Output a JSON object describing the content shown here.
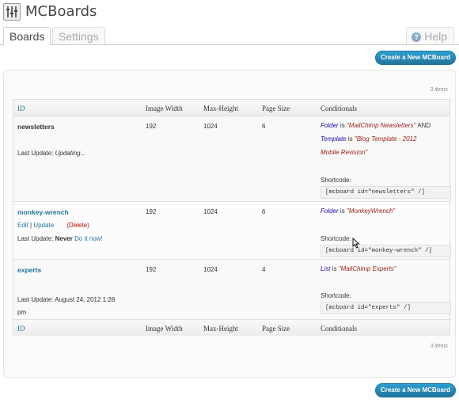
{
  "app": {
    "title": "MCBoards"
  },
  "tabs": [
    {
      "label": "Boards",
      "active": true
    },
    {
      "label": "Settings",
      "active": false
    }
  ],
  "help": {
    "label": "Help",
    "icon": "help-icon"
  },
  "buttons": {
    "create_label": "Create a New MCBoard"
  },
  "items_count": "3 items",
  "columns": [
    "ID",
    "Image Width",
    "Max-Height",
    "Page Size",
    "Conditionals"
  ],
  "rows": [
    {
      "name": "newsletters",
      "image_width": "192",
      "max_height": "1024",
      "page_size": "6",
      "last_update_label": "Last Update:",
      "last_update_value": "Updating...",
      "cond_line1_field": "Folder",
      "cond_line1_is": "is",
      "cond_line1_value": "\"MailChimp Newsletters\"",
      "cond_line1_and": "AND",
      "cond_line2_field": "Template",
      "cond_line2_is": "is",
      "cond_line2_value": "\"Blog Template - 2012",
      "cond_line3_value": "Mobile Revision\"",
      "shortcode_label": "Shortcode:",
      "shortcode": "[mcboard id=\"newsletters\" /]"
    },
    {
      "name": "monkey-wrench",
      "image_width": "192",
      "max_height": "1024",
      "page_size": "6",
      "actions": {
        "edit": "Edit",
        "separator": "|",
        "update": "Update",
        "delete": "(Delete)"
      },
      "last_update_label": "Last Update:",
      "last_update_value": "Never",
      "do_it_now": "Do it now!",
      "cond_line1_field": "Folder",
      "cond_line1_is": "is",
      "cond_line1_value": "\"MonkeyWrench\"",
      "shortcode_label": "Shortcode:",
      "shortcode": "[mcboard id=\"monkey-wrench\" /]"
    },
    {
      "name": "experts",
      "image_width": "192",
      "max_height": "1024",
      "page_size": "4",
      "last_update_label": "Last Update: August 24, 2012 1:28",
      "last_update_value2": "pm",
      "cond_line1_field": "List",
      "cond_line1_is": "is",
      "cond_line1_value": "\"MailChimp Experts\"",
      "shortcode_label": "Shortcode:",
      "shortcode": "[mcboard id=\"experts\" /]"
    }
  ],
  "colors": {
    "link": "#21759b",
    "condition_field": "#1a0dab",
    "condition_value": "#9b1c1c",
    "delete": "#bc0b0b",
    "button": "#21759b"
  }
}
